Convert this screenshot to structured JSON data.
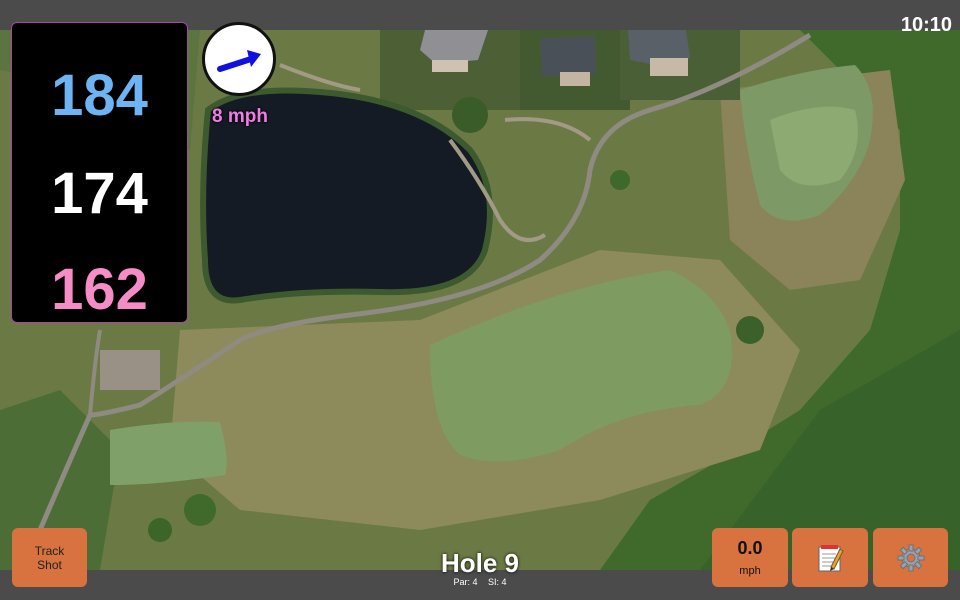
{
  "status": {
    "time": "10:10"
  },
  "distances": {
    "back": "184",
    "center": "174",
    "front": "162"
  },
  "wind": {
    "speed_label": "8 mph",
    "arrow_icon": "arrow-icon"
  },
  "hole": {
    "title": "Hole 9",
    "par_label": "Par: 4",
    "si_label": "SI: 4"
  },
  "buttons": {
    "track_shot_label": "Track Shot",
    "speed_value": "0.0",
    "speed_unit": "mph",
    "notes_icon": "notepad-icon",
    "settings_icon": "gear-icon"
  },
  "colors": {
    "back_distance": "#6fb4f2",
    "center_distance": "#ffffff",
    "front_distance": "#f58cc6",
    "wind_text": "#f07ce8",
    "button_bg": "#d8723e"
  }
}
